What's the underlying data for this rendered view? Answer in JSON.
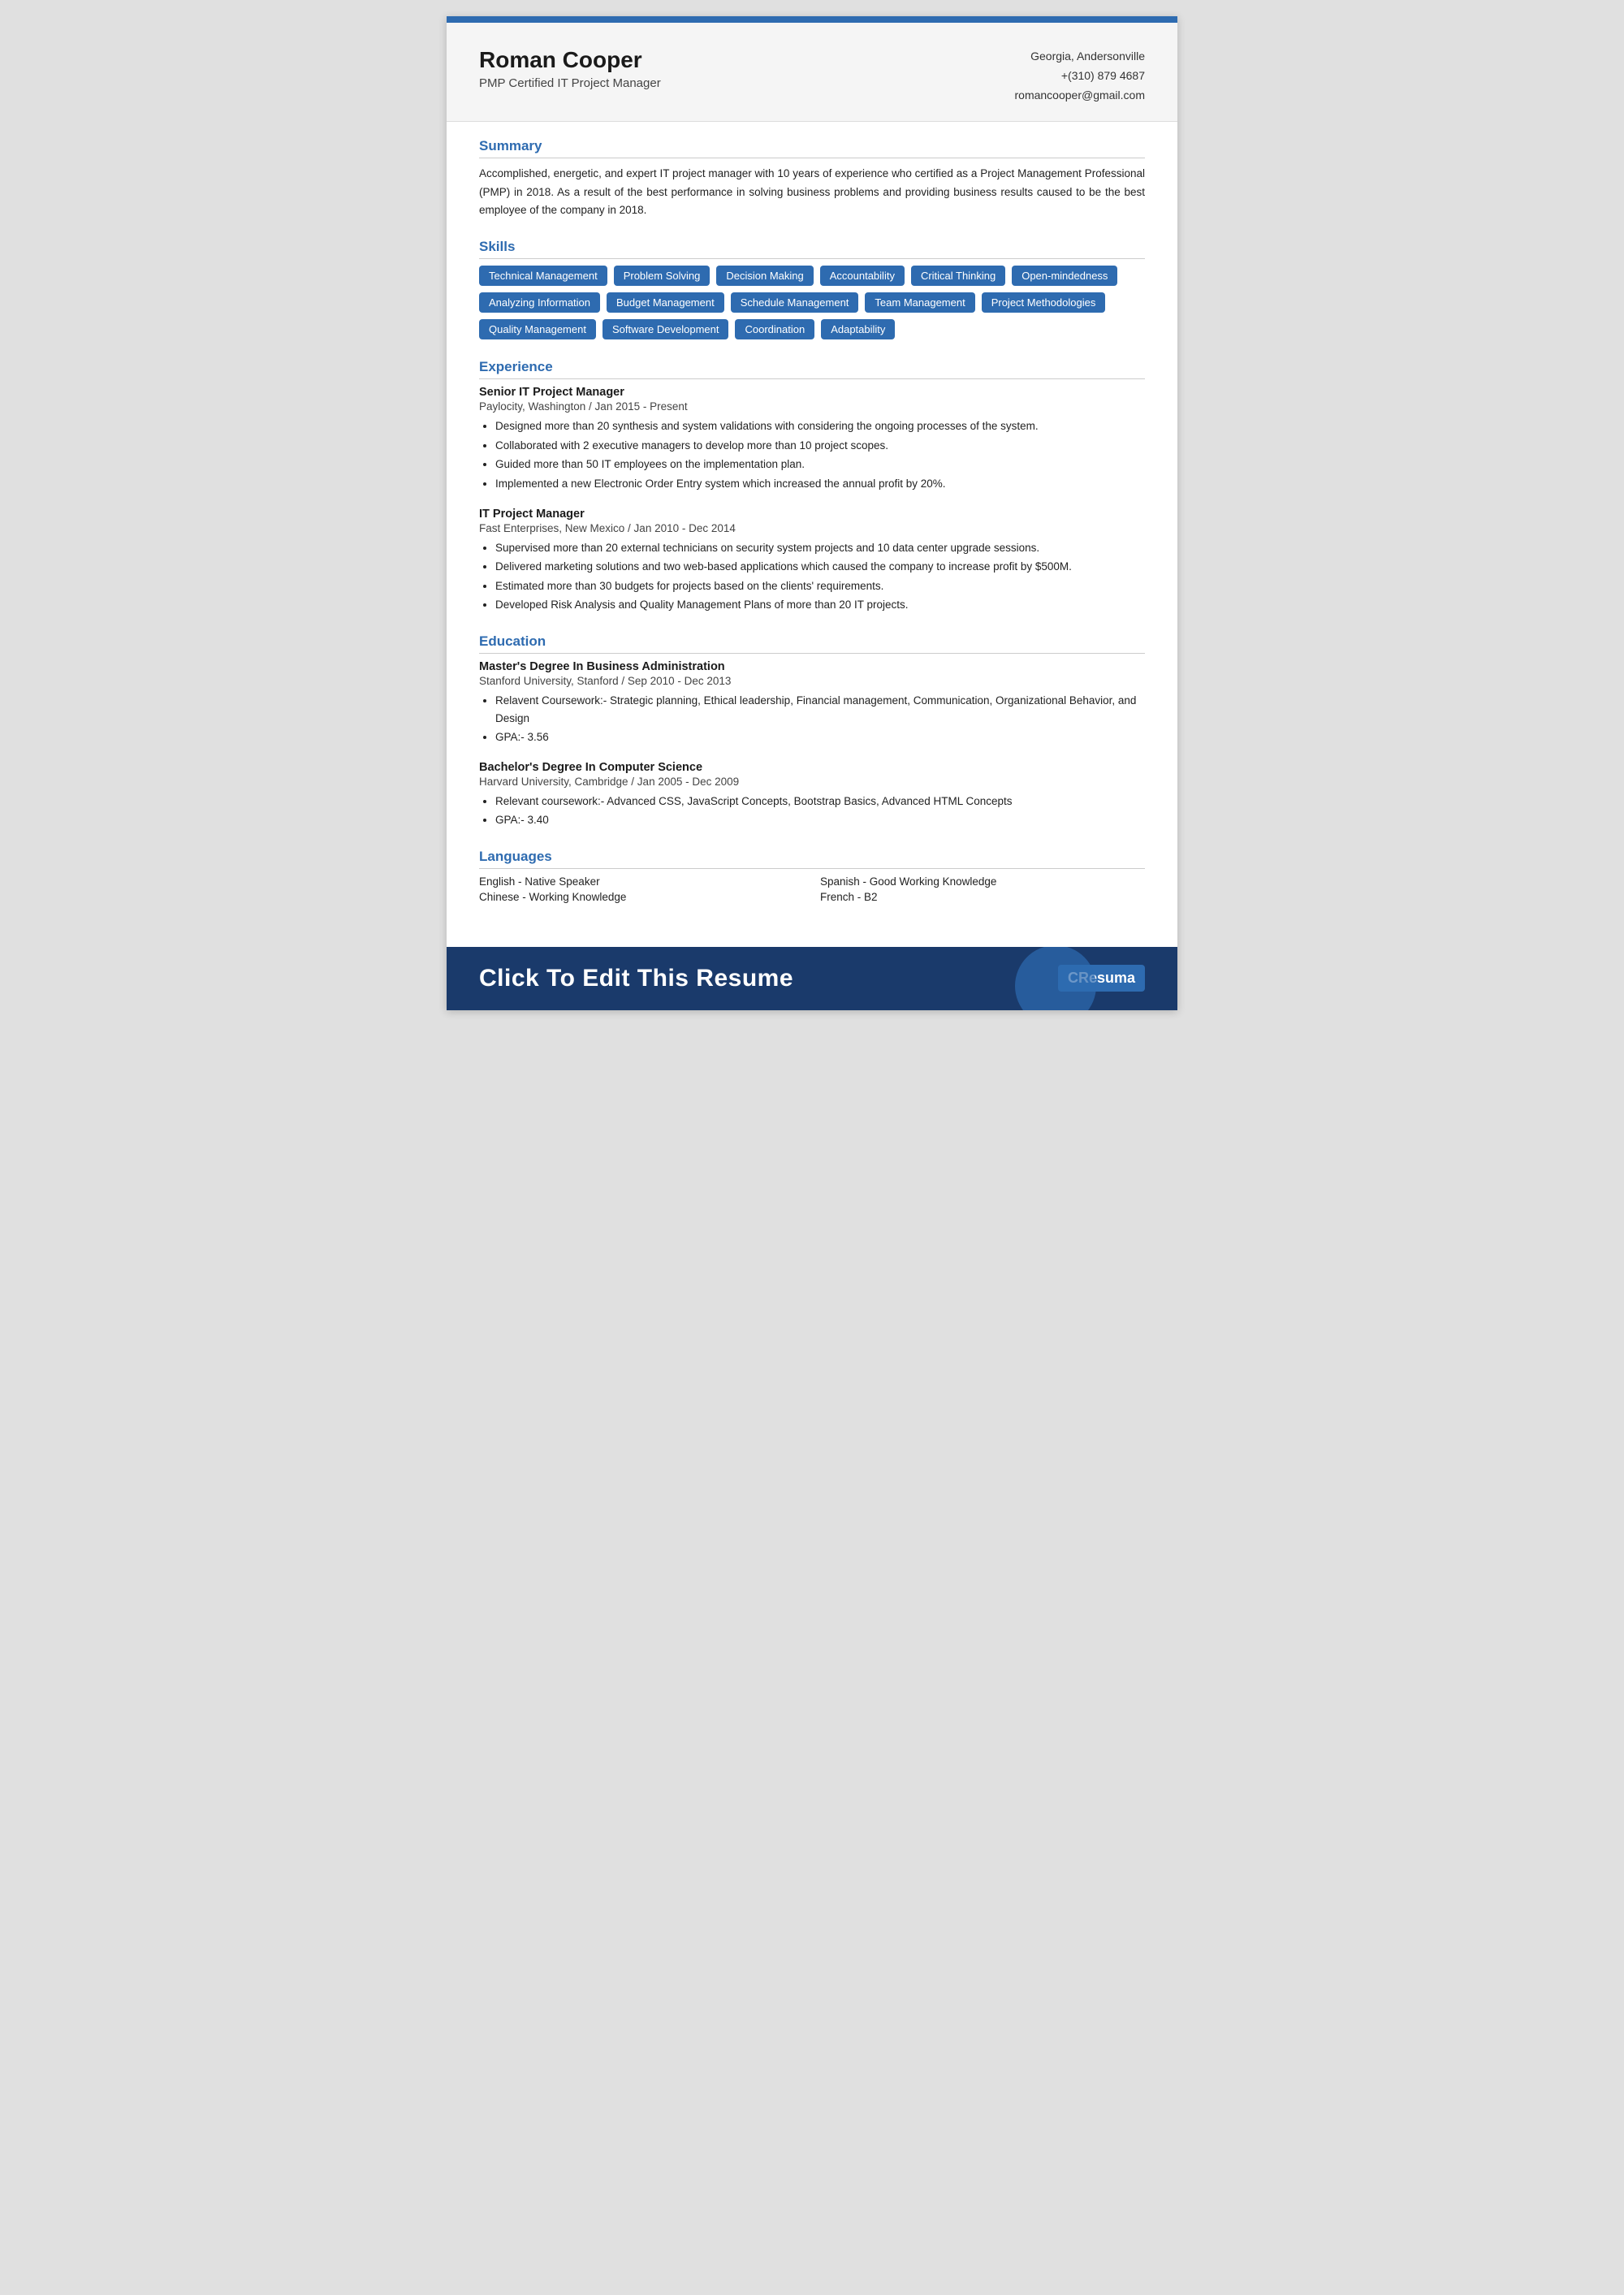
{
  "topBar": {},
  "header": {
    "name": "Roman Cooper",
    "title": "PMP Certified IT Project Manager",
    "location": "Georgia, Andersonville",
    "phone": "+(310) 879 4687",
    "email": "romancooper@gmail.com"
  },
  "sections": {
    "summary": {
      "title": "Summary",
      "text": "Accomplished, energetic, and expert IT project manager with 10 years of experience who certified as a Project Management Professional (PMP) in 2018. As a result of the best performance in solving business problems and providing business results caused to be the best employee of the company in 2018."
    },
    "skills": {
      "title": "Skills",
      "items": [
        "Technical Management",
        "Problem Solving",
        "Decision Making",
        "Accountability",
        "Critical Thinking",
        "Open-mindedness",
        "Analyzing Information",
        "Budget Management",
        "Schedule Management",
        "Team Management",
        "Project Methodologies",
        "Quality Management",
        "Software Development",
        "Coordination",
        "Adaptability"
      ]
    },
    "experience": {
      "title": "Experience",
      "jobs": [
        {
          "title": "Senior IT Project Manager",
          "company": "Paylocity, Washington / Jan 2015 - Present",
          "bullets": [
            "Designed more than 20 synthesis and system validations with considering the ongoing processes of the system.",
            "Collaborated with 2 executive managers to develop more than 10 project scopes.",
            "Guided more than 50 IT employees on the implementation plan.",
            "Implemented a new Electronic Order Entry system which increased the annual profit by 20%."
          ]
        },
        {
          "title": "IT Project Manager",
          "company": "Fast Enterprises, New Mexico / Jan 2010 - Dec 2014",
          "bullets": [
            "Supervised more than 20 external technicians on security system projects and 10 data center upgrade sessions.",
            "Delivered marketing solutions and two web-based applications which caused the company to increase profit by $500M.",
            "Estimated more than 30 budgets for projects based on the clients' requirements.",
            "Developed Risk Analysis and Quality Management Plans of more than 20 IT projects."
          ]
        }
      ]
    },
    "education": {
      "title": "Education",
      "degrees": [
        {
          "degree": "Master's Degree In Business Administration",
          "school": "Stanford University, Stanford / Sep 2010 - Dec 2013",
          "bullets": [
            "Relavent Coursework:- Strategic planning, Ethical leadership, Financial management, Communication, Organizational Behavior, and Design",
            "GPA:- 3.56"
          ]
        },
        {
          "degree": "Bachelor's Degree In Computer Science",
          "school": "Harvard University, Cambridge / Jan 2005 - Dec 2009",
          "bullets": [
            "Relevant coursework:- Advanced CSS, JavaScript Concepts,  Bootstrap Basics, Advanced HTML Concepts",
            "GPA:- 3.40"
          ]
        }
      ]
    },
    "languages": {
      "title": "Languages",
      "items": [
        "English - Native Speaker",
        "Spanish - Good Working Knowledge",
        "Chinese - Working Knowledge",
        "French - B2"
      ]
    }
  },
  "cta": {
    "text": "Click To Edit This Resume",
    "logo": "CResuma"
  }
}
